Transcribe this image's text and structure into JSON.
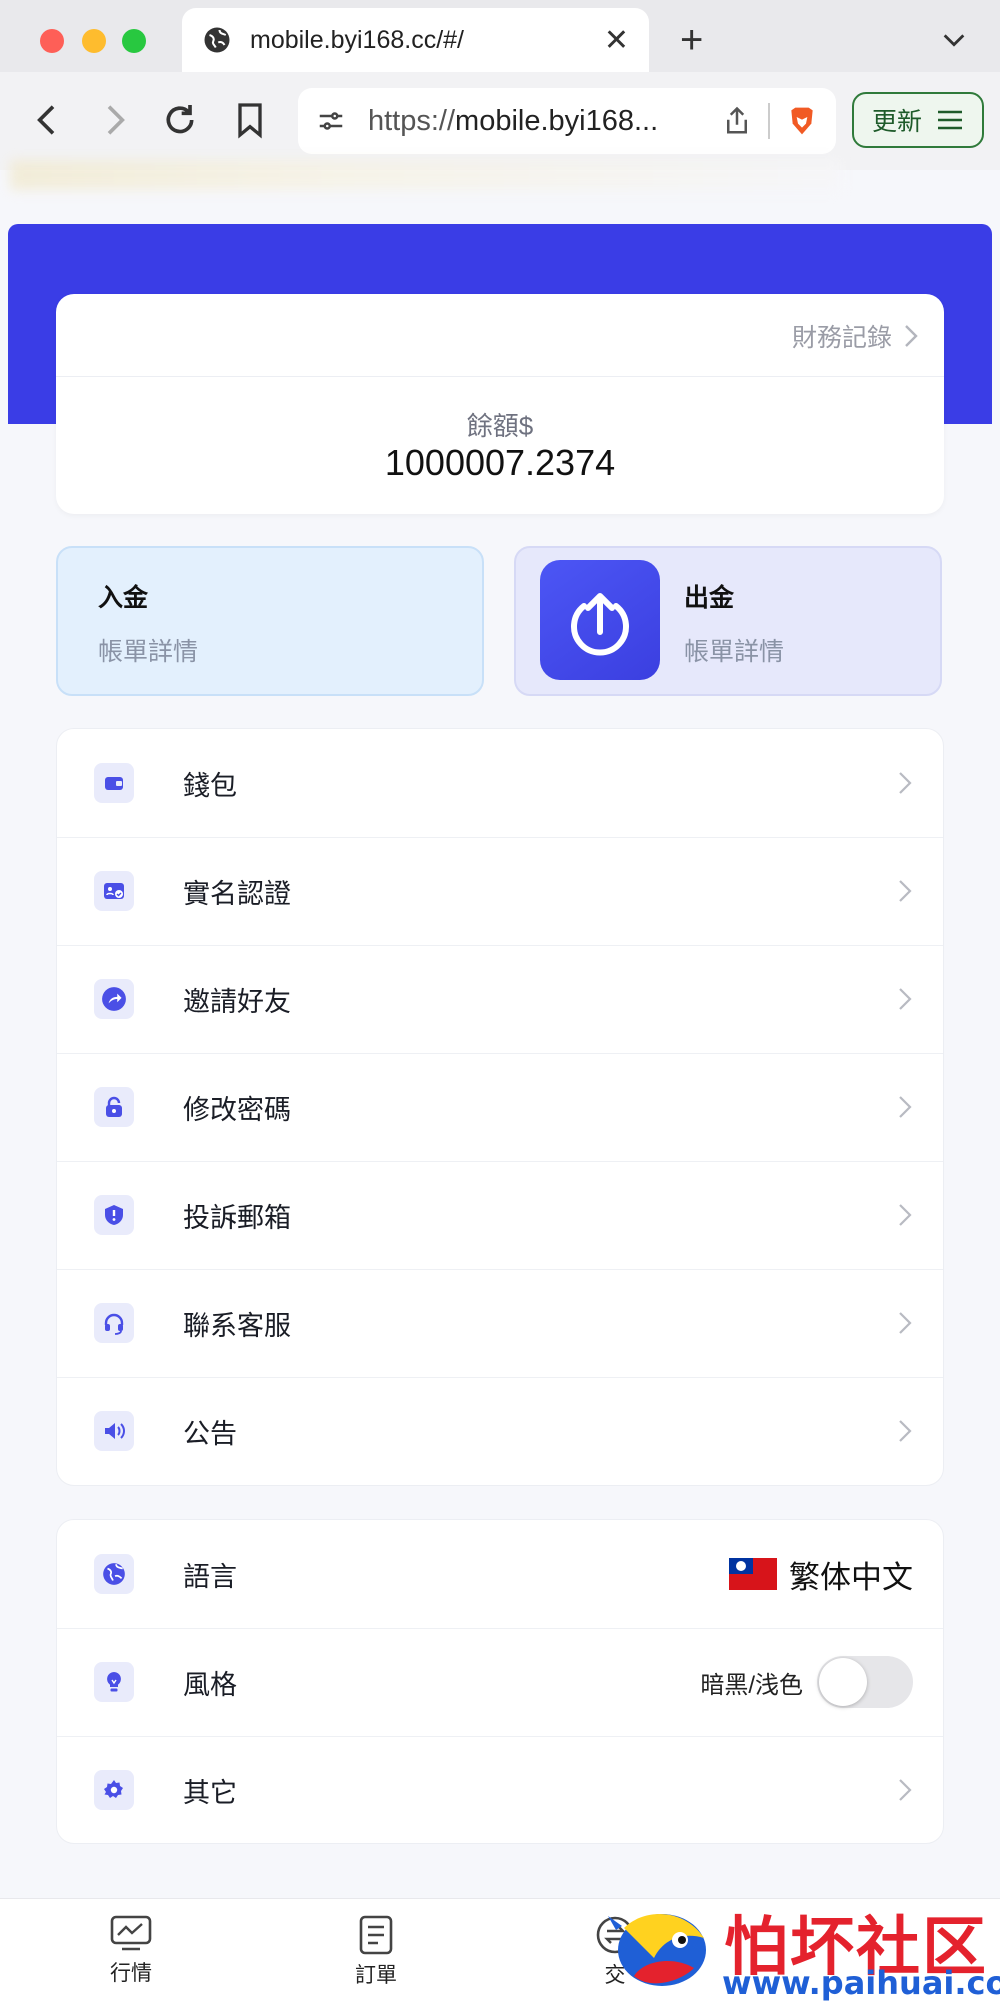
{
  "browser": {
    "tab_title": "mobile.byi168.cc/#/",
    "url_prefix": "https://",
    "url_domain": "mobile.byi168...",
    "update_label": "更新"
  },
  "balance_card": {
    "finance_link": "財務記錄",
    "balance_label": "餘額$",
    "balance_value": "1000007.2374"
  },
  "actions": {
    "deposit": {
      "title": "入金",
      "subtitle": "帳單詳情"
    },
    "withdraw": {
      "title": "出金",
      "subtitle": "帳單詳情"
    }
  },
  "menu": [
    {
      "label": "錢包",
      "icon": "wallet-icon"
    },
    {
      "label": "實名認證",
      "icon": "id-card-icon"
    },
    {
      "label": "邀請好友",
      "icon": "share-icon"
    },
    {
      "label": "修改密碼",
      "icon": "lock-icon"
    },
    {
      "label": "投訴郵箱",
      "icon": "shield-alert-icon"
    },
    {
      "label": "聯系客服",
      "icon": "headset-icon"
    },
    {
      "label": "公告",
      "icon": "speaker-icon"
    }
  ],
  "settings": {
    "language": {
      "label": "語言",
      "value": "繁体中文",
      "icon": "globe-icon"
    },
    "style": {
      "label": "風格",
      "value": "暗黑/浅色",
      "icon": "bulb-icon",
      "dark_mode": false
    },
    "other": {
      "label": "其它",
      "icon": "gear-icon"
    }
  },
  "bottom_nav": [
    {
      "label": "行情",
      "icon": "chart-icon"
    },
    {
      "label": "訂單",
      "icon": "document-icon"
    },
    {
      "label": "交",
      "icon": "exchange-icon"
    }
  ],
  "watermark": {
    "title": "怕坏社区",
    "url": "www.paihuai.com"
  },
  "colors": {
    "accent": "#3a3de6",
    "icon_tint": "#4a4fe6"
  }
}
